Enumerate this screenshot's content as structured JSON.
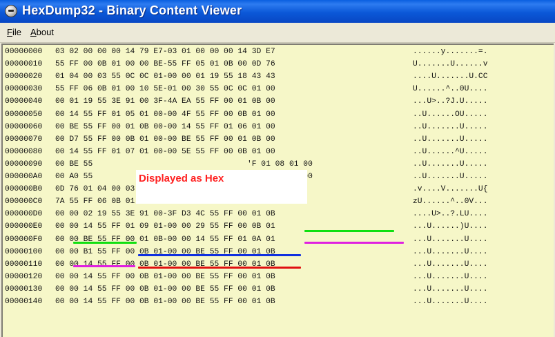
{
  "window": {
    "title": "HexDump32 - Binary Content Viewer"
  },
  "menu": [
    {
      "pre": "",
      "key": "F",
      "post": "ile"
    },
    {
      "pre": "",
      "key": "A",
      "post": "bout"
    }
  ],
  "overlay": {
    "label": "Displayed as Hex"
  },
  "rows": [
    {
      "addr": "00000000",
      "hex": "03 02 00 00 00 14 79 E7-03 01 00 00 00 14 3D E7",
      "ascii": "......y.......=."
    },
    {
      "addr": "00000010",
      "hex": "55 FF 00 0B 01 00 00 BE-55 FF 05 01 0B 00 0D 76",
      "ascii": "U.......U......v"
    },
    {
      "addr": "00000020",
      "hex": "01 04 00 03 55 0C 0C 01-00 00 01 19 55 18 43 43",
      "ascii": "....U.......U.CC"
    },
    {
      "addr": "00000030",
      "hex": "55 FF 06 0B 01 00 10 5E-01 00 30 55 0C 0C 01 00",
      "ascii": "U......^..0U...."
    },
    {
      "addr": "00000040",
      "hex": "00 01 19 55 3E 91 00 3F-4A EA 55 FF 00 01 0B 00",
      "ascii": "...U>..?J.U....."
    },
    {
      "addr": "00000050",
      "hex": "00 14 55 FF 01 05 01 00-00 4F 55 FF 00 0B 01 00",
      "ascii": "..U......OU....."
    },
    {
      "addr": "00000060",
      "hex": "00 BE 55 FF 00 01 0B 00-00 14 55 FF 01 06 01 00",
      "ascii": "..U.......U....."
    },
    {
      "addr": "00000070",
      "hex": "00 D7 55 FF 00 0B 01 00-00 BE 55 FF 00 01 0B 00",
      "ascii": "..U.......U....."
    },
    {
      "addr": "00000080",
      "hex": "00 14 55 FF 01 07 01 00-00 5E 55 FF 00 0B 01 00",
      "ascii": "..U......^U....."
    },
    {
      "addr": "00000090",
      "hex": "00 BE 55                                 'F 01 08 01 00",
      "ascii": "..U.......U....."
    },
    {
      "addr": "000000A0",
      "hex": "00 A0 55                                 'F 05 01 0B 00",
      "ascii": "..U.......U....."
    },
    {
      "addr": "000000B0",
      "hex": "0D 76 01 04 00 03 50 0C-0C 01 00 00 02 19 55 7B",
      "ascii": ".v....V.......U{"
    },
    {
      "addr": "000000C0",
      "hex": "7A 55 FF 06 0B 01 00 10-5E 01 00 30 56 0C 0C 01",
      "ascii": "zU......^..0V..."
    },
    {
      "addr": "000000D0",
      "hex": "00 00 02 19 55 3E 91 00-3F D3 4C 55 FF 00 01 0B",
      "ascii": "....U>..?.LU...."
    },
    {
      "addr": "000000E0",
      "hex": "00 00 14 55 FF 01 09 01-00 00 29 55 FF 00 0B 01",
      "ascii": "...U......)U...."
    },
    {
      "addr": "000000F0",
      "hex": "00 00 BE 55 FF 00 01 0B-00 00 14 55 FF 01 0A 01",
      "ascii": "...U.......U...."
    },
    {
      "addr": "00000100",
      "hex": "00 00 B1 55 FF 00 0B 01-00 00 BE 55 FF 00 01 0B",
      "ascii": "...U.......U...."
    },
    {
      "addr": "00000110",
      "hex": "00 00 14 55 FF 00 0B 01-00 00 BE 55 FF 00 01 0B",
      "ascii": "...U.......U...."
    },
    {
      "addr": "00000120",
      "hex": "00 00 14 55 FF 00 0B 01-00 00 BE 55 FF 00 01 0B",
      "ascii": "...U.......U...."
    },
    {
      "addr": "00000130",
      "hex": "00 00 14 55 FF 00 0B 01-00 00 BE 55 FF 00 01 0B",
      "ascii": "...U.......U...."
    },
    {
      "addr": "00000140",
      "hex": "00 00 14 55 FF 00 0B 01-00 00 BE 55 FF 00 01 0B",
      "ascii": "...U.......U...."
    }
  ],
  "annotation_colors": {
    "green": "#10e010",
    "blue": "#1030e0",
    "magenta": "#e020e0",
    "red": "#e01010"
  }
}
